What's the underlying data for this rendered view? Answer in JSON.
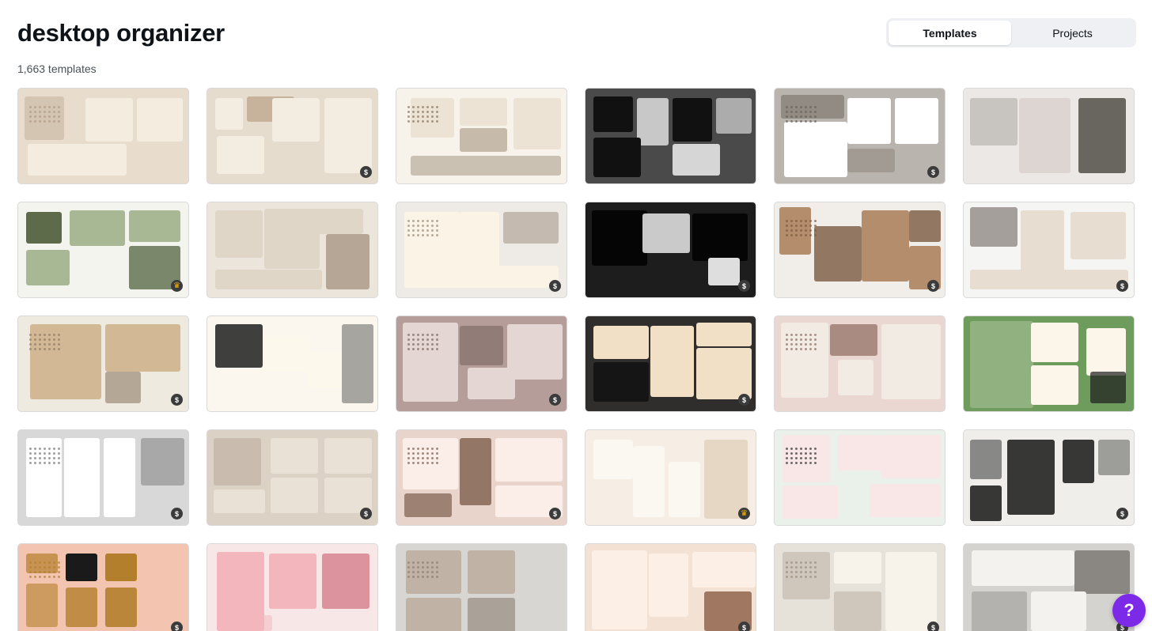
{
  "header": {
    "title": "desktop organizer",
    "count_label": "1,663 templates"
  },
  "view_toggle": {
    "templates_label": "Templates",
    "projects_label": "Projects",
    "selected": "Templates"
  },
  "help_button": {
    "label": "?"
  },
  "templates": [
    {
      "bg": "#e8dccd",
      "accent": "#f5ece0",
      "dark": "#b09a82",
      "badge": "none"
    },
    {
      "bg": "#e6dccd",
      "accent": "#f3ece1",
      "dark": "#a8876a",
      "badge": "paid"
    },
    {
      "bg": "#f7f3ea",
      "accent": "#ece3d4",
      "dark": "#8a7560",
      "badge": "none"
    },
    {
      "bg": "#4a4a4a",
      "accent": "#d6d6d6",
      "dark": "#111111",
      "badge": "none"
    },
    {
      "bg": "#b9b4ad",
      "accent": "#ffffff",
      "dark": "#6a625a",
      "badge": "paid"
    },
    {
      "bg": "#ece8e6",
      "accent": "#dcd5d2",
      "dark": "#5b5650",
      "badge": "none"
    },
    {
      "bg": "#f4f4ee",
      "accent": "#a9b894",
      "dark": "#5d6b4a",
      "badge": "premium"
    },
    {
      "bg": "#ebe5dc",
      "accent": "#dfd6c8",
      "dark": "#9f8b76",
      "badge": "none"
    },
    {
      "bg": "#eeebe6",
      "accent": "#fbf3e6",
      "dark": "#9b8a78",
      "badge": "paid"
    },
    {
      "bg": "#1d1d1d",
      "accent": "#dedede",
      "dark": "#050505",
      "badge": "paid"
    },
    {
      "bg": "#f1ede9",
      "accent": "#b48d6c",
      "dark": "#7a5a40",
      "badge": "paid"
    },
    {
      "bg": "#f5f5f3",
      "accent": "#e7ddd1",
      "dark": "#6e6560",
      "badge": "paid"
    },
    {
      "bg": "#efeae0",
      "accent": "#d3b896",
      "dark": "#8d7a62",
      "badge": "paid"
    },
    {
      "bg": "#fbf7ee",
      "accent": "#fcf8ec",
      "dark": "#2a2a2a",
      "badge": "none"
    },
    {
      "bg": "#b59e99",
      "accent": "#e4d7d3",
      "dark": "#7b6660",
      "badge": "paid"
    },
    {
      "bg": "#2f2e2c",
      "accent": "#f1dfc6",
      "dark": "#151515",
      "badge": "paid"
    },
    {
      "bg": "#ead7d2",
      "accent": "#f1ebe3",
      "dark": "#8d6b60",
      "badge": "none"
    },
    {
      "bg": "#6e9c5c",
      "accent": "#fbf5ea",
      "dark": "#1d1d1d",
      "badge": "none"
    },
    {
      "bg": "#d8d8d8",
      "accent": "#ffffff",
      "dark": "#777777",
      "badge": "paid"
    },
    {
      "bg": "#dcd1c5",
      "accent": "#e9e1d6",
      "dark": "#8f7d6b",
      "badge": "paid"
    },
    {
      "bg": "#e8d4cb",
      "accent": "#fbeee9",
      "dark": "#7e5e4c",
      "badge": "paid"
    },
    {
      "bg": "#f6eee5",
      "accent": "#fbf8f2",
      "dark": "#c6ab86",
      "badge": "premium"
    },
    {
      "bg": "#eaf1ea",
      "accent": "#f9e6e6",
      "dark": "#333333",
      "badge": "none"
    },
    {
      "bg": "#efeeea",
      "accent": "#ffffff",
      "dark": "#222222",
      "badge": "paid"
    },
    {
      "bg": "#f3c4b0",
      "accent": "#1a1a1a",
      "dark": "#b47f2c",
      "badge": "paid"
    },
    {
      "bg": "#f7e7e7",
      "accent": "#f3b6bd",
      "dark": "#d88a95",
      "badge": "none"
    },
    {
      "bg": "#d8d6d2",
      "accent": "#c1b2a6",
      "dark": "#8c7e72",
      "badge": "none"
    },
    {
      "bg": "#f3e1d3",
      "accent": "#fbefe6",
      "dark": "#8b5e45",
      "badge": "paid"
    },
    {
      "bg": "#e6e1d9",
      "accent": "#f7f2ea",
      "dark": "#9a8b7c",
      "badge": "paid"
    },
    {
      "bg": "#d5d3d0",
      "accent": "#f4f2ef",
      "dark": "#6a6763",
      "badge": "paid"
    }
  ]
}
